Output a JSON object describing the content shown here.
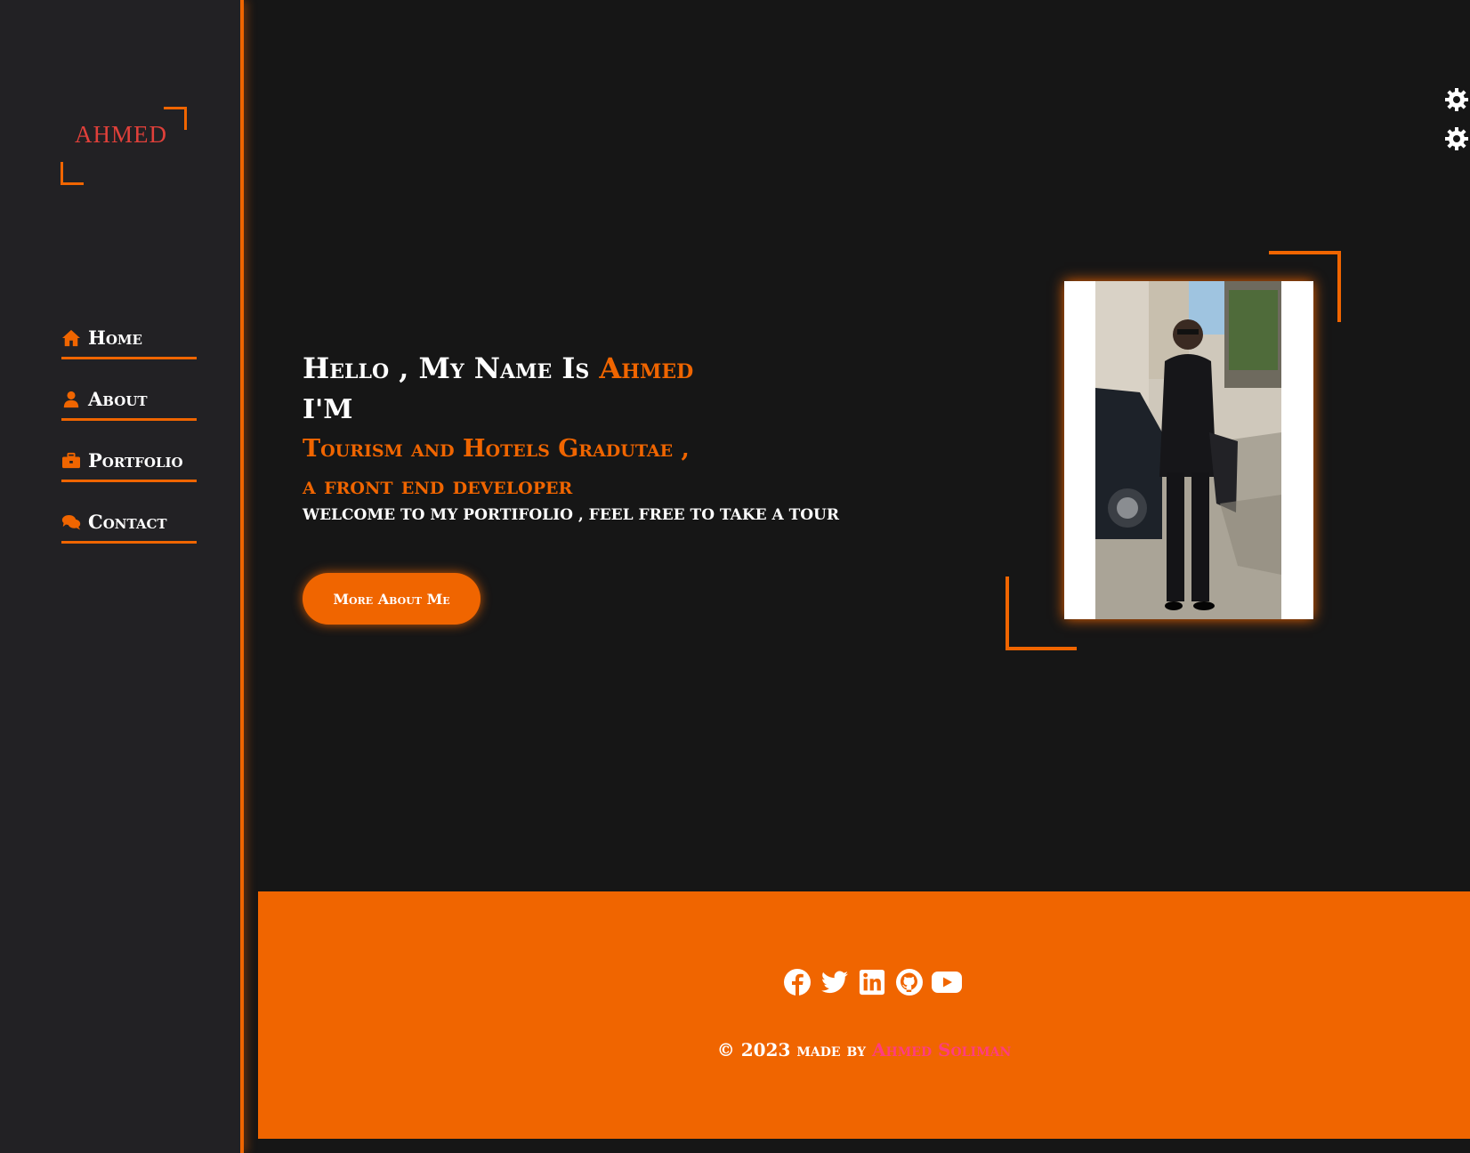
{
  "logo": {
    "text": "AHMED"
  },
  "nav": {
    "items": [
      {
        "label": "Home",
        "icon": "home-icon"
      },
      {
        "label": "About",
        "icon": "user-icon"
      },
      {
        "label": "Portfolio",
        "icon": "briefcase-icon"
      },
      {
        "label": "Contact",
        "icon": "comments-icon"
      }
    ]
  },
  "hero": {
    "greeting": "Hello , My Name Is",
    "name": "Ahmed",
    "im": "I'm",
    "role_line1": "Tourism and Hotels Gradutae ,",
    "role_line2": "a front end developer",
    "welcome": "welcome to my portifolio , feel free to take a tour",
    "cta_label": "More About Me"
  },
  "photo": {
    "description_icon": "portrait-photo"
  },
  "settings": {
    "icons": [
      "gear-icon",
      "gear-icon"
    ]
  },
  "footer": {
    "socials": [
      "facebook-icon",
      "twitter-icon",
      "linkedin-icon",
      "github-icon",
      "youtube-icon"
    ],
    "copyright_prefix": "© 2023 made by",
    "author": "Ahmed Soliman"
  },
  "colors": {
    "accent": "#f06500",
    "background": "#161616",
    "sidebar": "#222124",
    "author_link": "#ff3d7f"
  }
}
